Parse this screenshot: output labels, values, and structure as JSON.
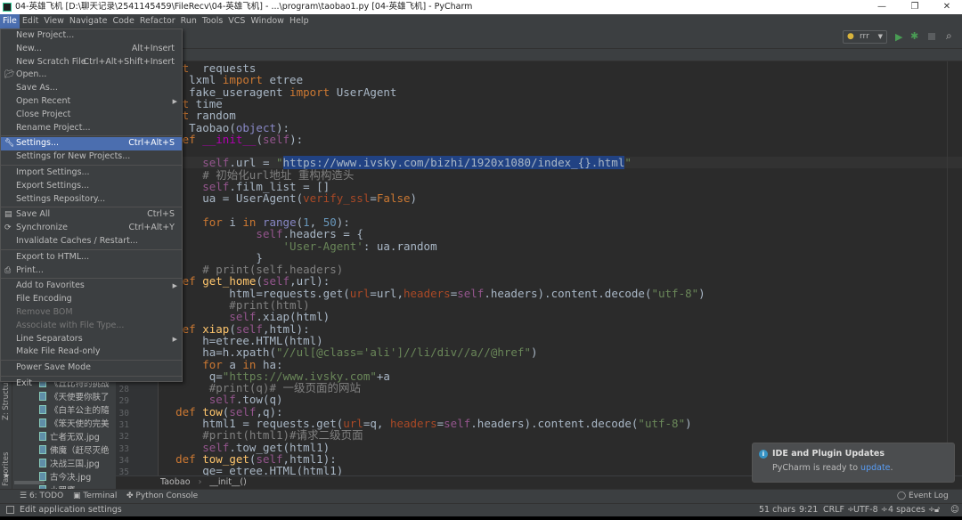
{
  "window": {
    "title": "04-英雄飞机 [D:\\聊天记录\\2541145459\\FileRecv\\04-英雄飞机] - ...\\program\\taobao1.py [04-英雄飞机] - PyCharm",
    "controls": [
      "—",
      "❐",
      "✕"
    ]
  },
  "menubar": [
    "File",
    "Edit",
    "View",
    "Navigate",
    "Code",
    "Refactor",
    "Run",
    "Tools",
    "VCS",
    "Window",
    "Help"
  ],
  "toolbar": {
    "run_config": "rrr"
  },
  "file_menu": [
    {
      "label": "New Project..."
    },
    {
      "label": "New...",
      "shortcut": "Alt+Insert"
    },
    {
      "label": "New Scratch File",
      "shortcut": "Ctrl+Alt+Shift+Insert"
    },
    {
      "label": "Open...",
      "icon": "folder-icon"
    },
    {
      "label": "Save As..."
    },
    {
      "label": "Open Recent",
      "submenu": true
    },
    {
      "label": "Close Project"
    },
    {
      "label": "Rename Project..."
    },
    {
      "sep": true
    },
    {
      "label": "Settings...",
      "shortcut": "Ctrl+Alt+S",
      "icon": "wrench-icon",
      "highlighted": true
    },
    {
      "label": "Settings for New Projects..."
    },
    {
      "sep": true
    },
    {
      "label": "Import Settings..."
    },
    {
      "label": "Export Settings..."
    },
    {
      "label": "Settings Repository..."
    },
    {
      "sep": true
    },
    {
      "label": "Save All",
      "shortcut": "Ctrl+S",
      "icon": "save-icon"
    },
    {
      "label": "Synchronize",
      "shortcut": "Ctrl+Alt+Y",
      "icon": "sync-icon"
    },
    {
      "label": "Invalidate Caches / Restart..."
    },
    {
      "sep": true
    },
    {
      "label": "Export to HTML..."
    },
    {
      "label": "Print...",
      "icon": "print-icon"
    },
    {
      "sep": true
    },
    {
      "label": "Add to Favorites",
      "submenu": true
    },
    {
      "label": "File Encoding"
    },
    {
      "label": "Remove BOM",
      "disabled": true
    },
    {
      "label": "Associate with File Type...",
      "disabled": true
    },
    {
      "label": "Line Separators",
      "submenu": true
    },
    {
      "label": "Make File Read-only"
    },
    {
      "sep": true
    },
    {
      "label": "Power Save Mode"
    },
    {
      "sep": true
    },
    {
      "label": "Exit"
    }
  ],
  "left_strip": {
    "structure": "Z: Structure",
    "favorites": "2: Favorites"
  },
  "project_tree": [
    "《丘比特的挑战",
    "《天使要你肤了",
    "《白羊公主的隨",
    "《笨天使的完美",
    "亡者无双.jpg",
    "佛魔（赶尽灭绝",
    "决战三国.jpg",
    "古今决.jpg",
    "小罗鹰"
  ],
  "line_numbers": [
    "28",
    "29",
    "30",
    "31",
    "32",
    "33",
    "34",
    "35"
  ],
  "code_lines": [
    [
      [
        "kw",
        "import"
      ],
      [
        "",
        "  requests"
      ]
    ],
    [
      [
        "kw",
        "from"
      ],
      [
        "",
        "  lxml "
      ],
      [
        "kw",
        "import"
      ],
      [
        "",
        " etree"
      ]
    ],
    [
      [
        "kw",
        "from"
      ],
      [
        "",
        "  fake_useragent "
      ],
      [
        "kw",
        "import"
      ],
      [
        "",
        " UserAgent"
      ]
    ],
    [
      [
        "kw",
        "import"
      ],
      [
        "",
        " time"
      ]
    ],
    [
      [
        "kw",
        "import"
      ],
      [
        "",
        " random"
      ]
    ],
    [
      [
        "kw",
        "class"
      ],
      [
        "",
        " Taobao("
      ],
      [
        "bi",
        "object"
      ],
      [
        "",
        "):"
      ]
    ],
    [
      [
        "",
        "    "
      ],
      [
        "kw",
        "def"
      ],
      [
        "",
        " "
      ],
      [
        "mg",
        "__init__"
      ],
      [
        "",
        "("
      ],
      [
        "sf",
        "self"
      ],
      [
        "",
        "):"
      ]
    ],
    [],
    [
      [
        "",
        "        "
      ],
      [
        "sf",
        "self"
      ],
      [
        "",
        ".url = "
      ],
      [
        "st",
        "\""
      ],
      [
        "sel",
        "https://www.ivsky.com/bizhi/1920x1080/index_{}.html"
      ],
      [
        "st",
        "\""
      ]
    ],
    [
      [
        "cm",
        "        # 初始化url地址 重构构造头"
      ]
    ],
    [
      [
        "",
        "        "
      ],
      [
        "sf",
        "self"
      ],
      [
        "",
        ".film_list = []"
      ]
    ],
    [
      [
        "",
        "        ua = UserAgent("
      ],
      [
        "pr",
        "verify_ssl"
      ],
      [
        "",
        "="
      ],
      [
        "kw",
        "False"
      ],
      [
        "",
        ")"
      ]
    ],
    [],
    [
      [
        "",
        "        "
      ],
      [
        "kw",
        "for"
      ],
      [
        "",
        " i "
      ],
      [
        "kw",
        "in"
      ],
      [
        "",
        " "
      ],
      [
        "bi",
        "range"
      ],
      [
        "",
        "("
      ],
      [
        "nb",
        "1"
      ],
      [
        "",
        ", "
      ],
      [
        "nb",
        "50"
      ],
      [
        "",
        "):"
      ]
    ],
    [
      [
        "",
        "                "
      ],
      [
        "sf",
        "self"
      ],
      [
        "",
        ".headers = {"
      ]
    ],
    [
      [
        "",
        "                    "
      ],
      [
        "st",
        "'User-Agent'"
      ],
      [
        "",
        ": ua.random"
      ]
    ],
    [
      [
        "",
        "                }"
      ]
    ],
    [
      [
        "cm",
        "        # print(self.headers)"
      ]
    ],
    [
      [
        "",
        "    "
      ],
      [
        "kw",
        "def"
      ],
      [
        "",
        " "
      ],
      [
        "fn",
        "get_home"
      ],
      [
        "",
        "("
      ],
      [
        "sf",
        "self"
      ],
      [
        "",
        ",url):"
      ]
    ],
    [
      [
        "",
        "            html=requests.get("
      ],
      [
        "pr",
        "url"
      ],
      [
        "",
        "=url,"
      ],
      [
        "pr",
        "headers"
      ],
      [
        "",
        "="
      ],
      [
        "sf",
        "self"
      ],
      [
        "",
        ".headers).content.decode("
      ],
      [
        "st",
        "\"utf-8\""
      ],
      [
        "",
        ")"
      ]
    ],
    [
      [
        "cm",
        "            #print(html)"
      ]
    ],
    [
      [
        "",
        "            "
      ],
      [
        "sf",
        "self"
      ],
      [
        "",
        ".xiap(html)"
      ]
    ],
    [
      [
        "",
        "    "
      ],
      [
        "kw",
        "def"
      ],
      [
        "",
        " "
      ],
      [
        "fn",
        "xiap"
      ],
      [
        "",
        "("
      ],
      [
        "sf",
        "self"
      ],
      [
        "",
        ",html):"
      ]
    ],
    [
      [
        "",
        "        h=etree.HTML(html)"
      ]
    ],
    [
      [
        "",
        "        ha=h.xpath("
      ],
      [
        "st",
        "\"//ul[@class='ali']//li/div//a//@href\""
      ],
      [
        "",
        ")"
      ]
    ],
    [
      [
        "",
        "        "
      ],
      [
        "kw",
        "for"
      ],
      [
        "",
        " a "
      ],
      [
        "kw",
        "in"
      ],
      [
        "",
        " ha:"
      ]
    ],
    [
      [
        "",
        "         q="
      ],
      [
        "st",
        "\"https://www.ivsky.com\""
      ],
      [
        "",
        "+a"
      ]
    ],
    [
      [
        "cm",
        "         #print(q)# 一级页面的网站"
      ]
    ],
    [
      [
        "",
        "         "
      ],
      [
        "sf",
        "self"
      ],
      [
        "",
        ".tow(q)"
      ]
    ],
    [
      [
        "",
        "    "
      ],
      [
        "kw",
        "def"
      ],
      [
        "",
        " "
      ],
      [
        "fn",
        "tow"
      ],
      [
        "",
        "("
      ],
      [
        "sf",
        "self"
      ],
      [
        "",
        ",q):"
      ]
    ],
    [
      [
        "",
        "        html1 = requests.get("
      ],
      [
        "pr",
        "url"
      ],
      [
        "",
        "=q, "
      ],
      [
        "pr",
        "headers"
      ],
      [
        "",
        "="
      ],
      [
        "sf",
        "self"
      ],
      [
        "",
        ".headers).content.decode("
      ],
      [
        "st",
        "\"utf-8\""
      ],
      [
        "",
        ")"
      ]
    ],
    [
      [
        "cm",
        "        #print(html1)#请求二级页面"
      ]
    ],
    [
      [
        "",
        "        "
      ],
      [
        "sf",
        "self"
      ],
      [
        "",
        ".tow_get(html1)"
      ]
    ],
    [
      [
        "",
        "    "
      ],
      [
        "kw",
        "def"
      ],
      [
        "",
        " "
      ],
      [
        "fn",
        "tow_get"
      ],
      [
        "",
        "("
      ],
      [
        "sf",
        "self"
      ],
      [
        "",
        ",html1):"
      ]
    ],
    [
      [
        "",
        "        qe= etree.HTML(html1)"
      ]
    ]
  ],
  "breadcrumb": [
    "Taobao",
    "__init__()"
  ],
  "bottom_tools": {
    "todo": "6: TODO",
    "terminal": "Terminal",
    "python_console": "Python Console",
    "event_log": "Event Log"
  },
  "notification": {
    "title": "IDE and Plugin Updates",
    "text": "PyCharm is ready to ",
    "link": "update",
    "end": "."
  },
  "status": {
    "message": "Edit application settings",
    "chars": "51 chars",
    "position": "9:21",
    "line_sep": "CRLF ÷",
    "encoding": "UTF-8 ÷",
    "indent": "4 spaces ÷"
  },
  "colors": {
    "accent": "#4b6eaf",
    "editor_bg": "#2b2b2b",
    "panel_bg": "#3c3f41"
  }
}
